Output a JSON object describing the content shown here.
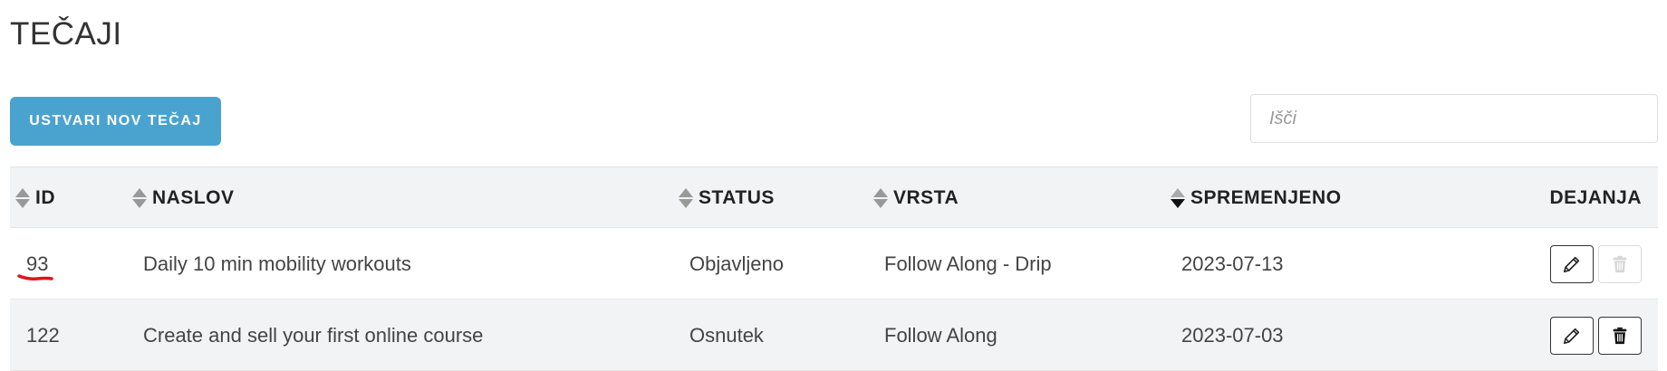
{
  "page": {
    "title": "TEČAJI"
  },
  "toolbar": {
    "create_label": "USTVARI NOV TEČAJ",
    "search_placeholder": "Išči"
  },
  "table": {
    "columns": {
      "id": "ID",
      "title": "NASLOV",
      "status": "STATUS",
      "type": "VRSTA",
      "modified": "SPREMENJENO",
      "actions": "DEJANJA"
    },
    "sorted_column": "modified",
    "sort_direction": "desc",
    "rows": [
      {
        "id": "93",
        "title": "Daily 10 min mobility workouts",
        "status": "Objavljeno",
        "type": "Follow Along - Drip",
        "modified": "2023-07-13",
        "delete_enabled": false
      },
      {
        "id": "122",
        "title": "Create and sell your first online course",
        "status": "Osnutek",
        "type": "Follow Along",
        "modified": "2023-07-03",
        "delete_enabled": true
      }
    ]
  },
  "icons": {
    "edit": "pencil-icon",
    "delete": "trash-icon",
    "sort": "sort-icon"
  },
  "colors": {
    "accent": "#4aa3cf",
    "header_bg": "#f2f3f4",
    "annotation": "#e0131a"
  }
}
